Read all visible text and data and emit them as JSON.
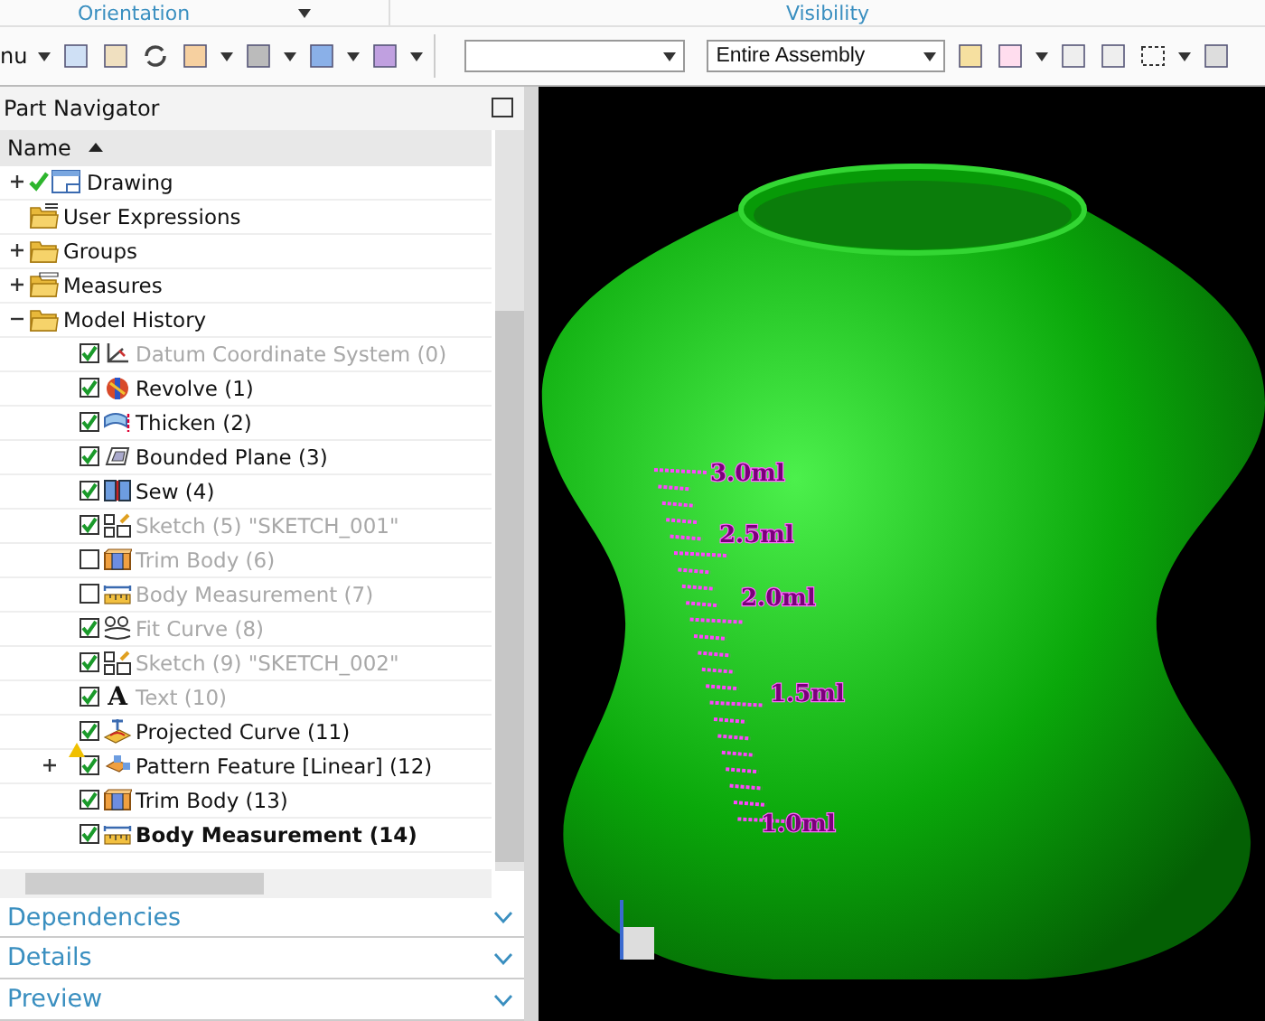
{
  "ribbon_groups": [
    {
      "label": "Orientation"
    },
    {
      "label": "Visibility"
    }
  ],
  "toolbar": {
    "menu_label": "nu",
    "assembly_scope": {
      "value": "Entire Assembly"
    }
  },
  "navigator": {
    "title": "Part Navigator",
    "column": {
      "label": "Name"
    },
    "tree": [
      {
        "label": "Drawing",
        "kind": "drawing",
        "expanded": false
      },
      {
        "label": "User Expressions",
        "kind": "expressions"
      },
      {
        "label": "Groups",
        "kind": "folder",
        "expanded": false
      },
      {
        "label": "Measures",
        "kind": "measures",
        "expanded": false
      },
      {
        "label": "Model History",
        "kind": "folder",
        "expanded": true,
        "children": [
          {
            "label": "Datum Coordinate System (0)",
            "kind": "datum",
            "checked": true,
            "greyed": true,
            "current": false
          },
          {
            "label": "Revolve (1)",
            "kind": "revolve",
            "checked": true,
            "greyed": false,
            "current": false
          },
          {
            "label": "Thicken (2)",
            "kind": "thicken",
            "checked": true,
            "greyed": false,
            "current": false
          },
          {
            "label": "Bounded Plane (3)",
            "kind": "plane",
            "checked": true,
            "greyed": false,
            "current": false
          },
          {
            "label": "Sew (4)",
            "kind": "sew",
            "checked": true,
            "greyed": false,
            "current": false
          },
          {
            "label": "Sketch (5) \"SKETCH_001\"",
            "kind": "sketch",
            "checked": true,
            "greyed": true,
            "current": false
          },
          {
            "label": "Trim Body (6)",
            "kind": "trim",
            "checked": false,
            "greyed": true,
            "current": false
          },
          {
            "label": "Body Measurement (7)",
            "kind": "measure",
            "checked": false,
            "greyed": true,
            "current": false
          },
          {
            "label": "Fit Curve (8)",
            "kind": "fitcurve",
            "checked": true,
            "greyed": true,
            "current": false
          },
          {
            "label": "Sketch (9) \"SKETCH_002\"",
            "kind": "sketch",
            "checked": true,
            "greyed": true,
            "current": false
          },
          {
            "label": "Text (10)",
            "kind": "text",
            "glyph": "A",
            "checked": true,
            "greyed": true,
            "current": false
          },
          {
            "label": "Projected Curve (11)",
            "kind": "projected",
            "checked": true,
            "greyed": false,
            "current": false
          },
          {
            "label": "Pattern Feature [Linear] (12)",
            "kind": "pattern",
            "checked": true,
            "greyed": false,
            "current": false,
            "expanded": false,
            "warning": true
          },
          {
            "label": "Trim Body (13)",
            "kind": "trim",
            "checked": true,
            "greyed": false,
            "current": false
          },
          {
            "label": "Body Measurement (14)",
            "kind": "measure",
            "checked": true,
            "greyed": false,
            "current": true
          }
        ]
      }
    ]
  },
  "panels": [
    {
      "label": "Dependencies"
    },
    {
      "label": "Details"
    },
    {
      "label": "Preview"
    }
  ],
  "viewport": {
    "scale_labels": [
      "3.0ml",
      "2.5ml",
      "2.0ml",
      "1.5ml",
      "1.0ml"
    ]
  }
}
